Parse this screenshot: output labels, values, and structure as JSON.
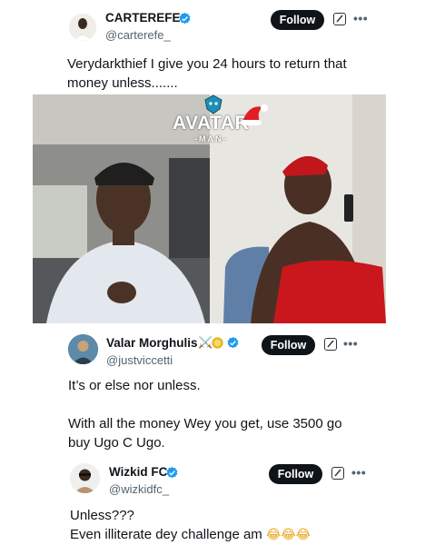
{
  "post1": {
    "name": "CARTEREFE",
    "handle": "@carterefe_",
    "follow_label": "Follow",
    "text_line1": "Verydarkthief I give you 24 hours to return that",
    "text_line2": "money unless.......",
    "media": {
      "watermark_brand": "AVATAR",
      "watermark_sub": "-MAN-"
    }
  },
  "reply1": {
    "name": "Valar Morghulis",
    "handle": "@justviccetti",
    "follow_label": "Follow",
    "name_emojis": "⚔️",
    "text_line1": "It’s or else nor unless.",
    "text_line2": "With all the money Wey you get, use 3500 go",
    "text_line3": "buy Ugo C Ugo."
  },
  "reply2": {
    "name": "Wizkid FC",
    "handle": "@wizkidfc_",
    "follow_label": "Follow",
    "text_line1": "Unless???",
    "text_line2": "Even illiterate dey challenge am",
    "text_emojis": "😂😂😂"
  },
  "colors": {
    "verified": "#1d9bf0",
    "gold_badge": "#e8b923",
    "follow_bg": "#0f1419",
    "handle_gray": "#536471"
  },
  "icons": [
    "verified-badge-icon",
    "edit-square-icon",
    "more-options-icon",
    "crossed-swords-icon",
    "santa-hat-icon"
  ]
}
